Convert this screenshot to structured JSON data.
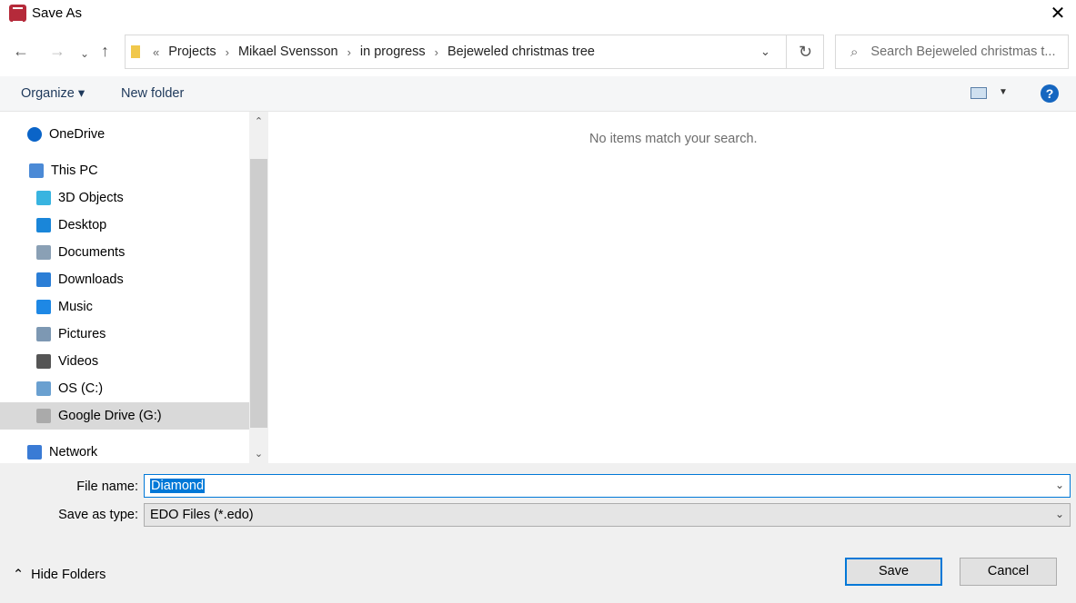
{
  "window": {
    "title": "Save As",
    "close_icon": "close-icon"
  },
  "address": {
    "overflow": "«",
    "crumbs": [
      "Projects",
      "Mikael Svensson",
      "in progress",
      "Bejeweled christmas tree"
    ]
  },
  "search": {
    "placeholder": "Search Bejeweled christmas t..."
  },
  "toolbar": {
    "organize": "Organize ▾",
    "new_folder": "New folder",
    "help": "?"
  },
  "nav": {
    "items": [
      {
        "label": "OneDrive",
        "icon": "cloud-icon",
        "color": "#0a64c8"
      },
      {
        "label": "This PC",
        "icon": "computer-icon",
        "color": "#4b8ad6"
      },
      {
        "label": "3D Objects",
        "icon": "cube-icon",
        "color": "#38b4e0"
      },
      {
        "label": "Desktop",
        "icon": "desktop-icon",
        "color": "#1a86d9"
      },
      {
        "label": "Documents",
        "icon": "document-icon",
        "color": "#8aa0b5"
      },
      {
        "label": "Downloads",
        "icon": "download-icon",
        "color": "#2b7ed6"
      },
      {
        "label": "Music",
        "icon": "music-icon",
        "color": "#1e88e5"
      },
      {
        "label": "Pictures",
        "icon": "pictures-icon",
        "color": "#7d98b3"
      },
      {
        "label": "Videos",
        "icon": "film-icon",
        "color": "#555555"
      },
      {
        "label": "OS (C:)",
        "icon": "drive-icon",
        "color": "#6aa0d0"
      },
      {
        "label": "Google Drive (G:)",
        "icon": "drive-icon",
        "color": "#aaaaaa"
      },
      {
        "label": "Network",
        "icon": "network-icon",
        "color": "#3a7bd5"
      }
    ]
  },
  "content": {
    "empty_message": "No items match your search."
  },
  "form": {
    "file_name_label": "File name:",
    "file_name": "Diamond",
    "type_label": "Save as type:",
    "type_value": "EDO Files (*.edo)"
  },
  "footer": {
    "hide_folders": "Hide Folders",
    "save": "Save",
    "cancel": "Cancel"
  }
}
